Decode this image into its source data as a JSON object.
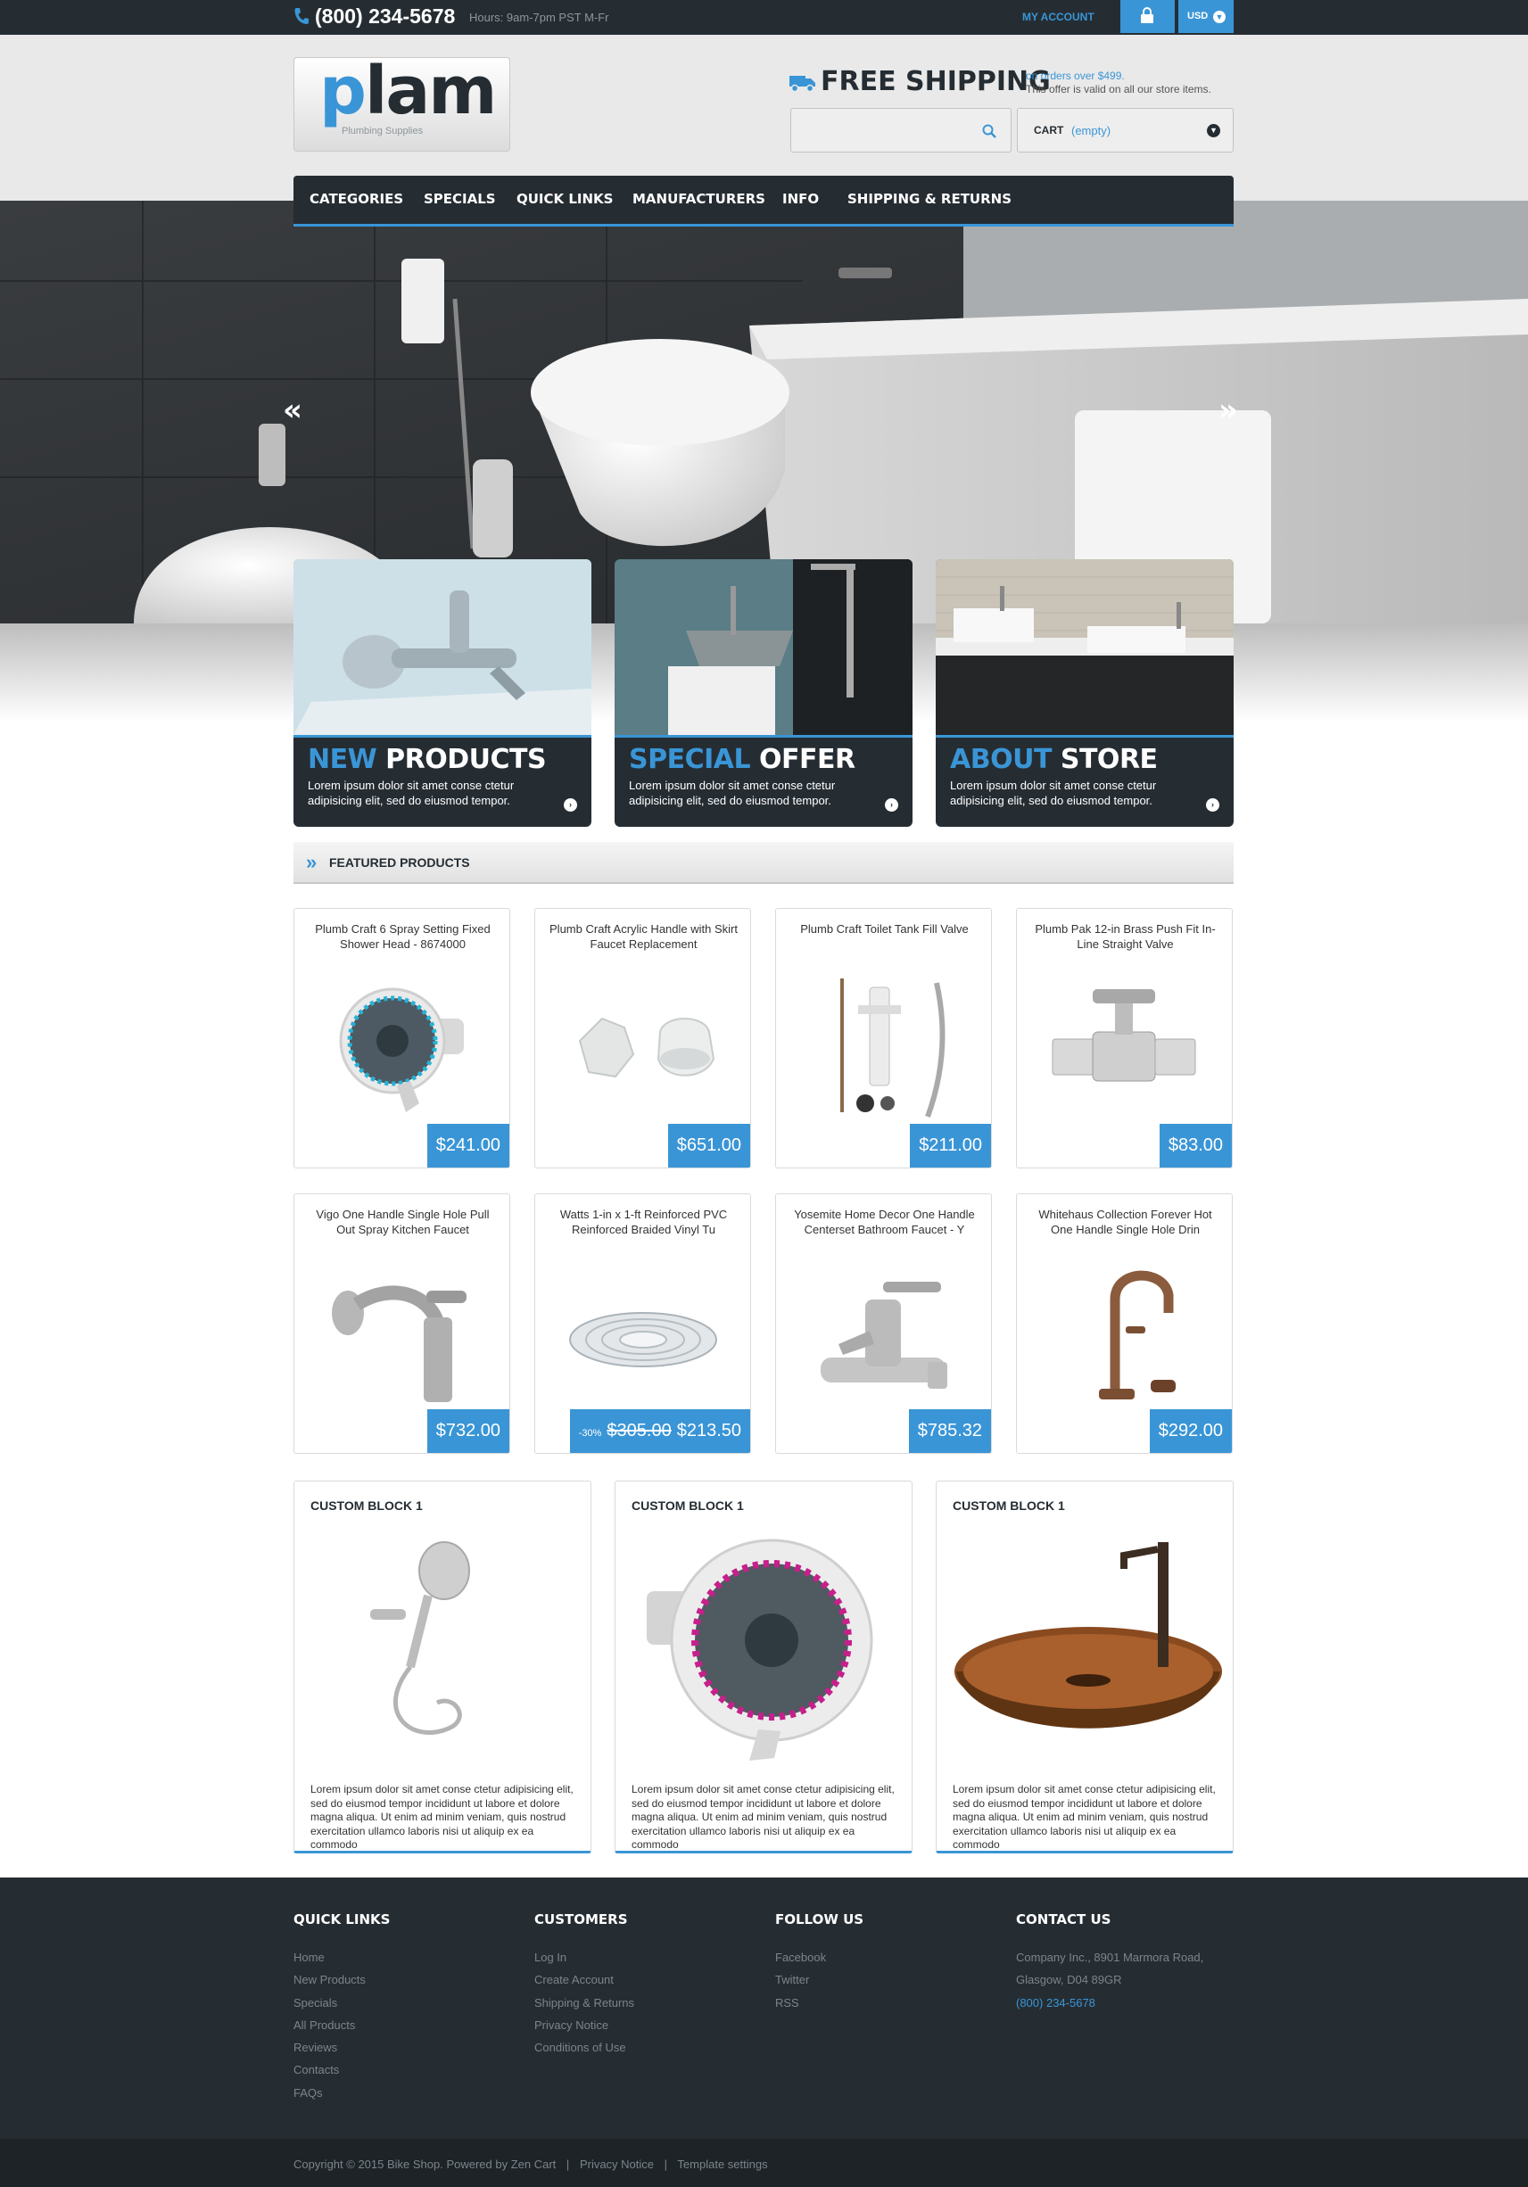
{
  "topbar": {
    "phone_icon": "phone-icon",
    "phone": "(800) 234-5678",
    "hours": "Hours: 9am-7pm PST M-Fr",
    "my_account": "MY ACCOUNT",
    "lock_icon": "lock-icon",
    "currency": "USD"
  },
  "header": {
    "logo_word": "lam",
    "logo_first": "p",
    "logo_sub": "Plumbing Supplies",
    "free_shipping": "FREE SHIPPING",
    "ship_note1": "on orders over $499.",
    "ship_note2": "This offer is valid on all our store items.",
    "search_placeholder": "",
    "cart_label": "CART",
    "cart_status": "(empty)"
  },
  "nav": [
    "CATEGORIES",
    "SPECIALS",
    "QUICK LINKS",
    "MANUFACTURERS",
    "INFO",
    "SHIPPING & RETURNS"
  ],
  "hero": {
    "prev_icon": "double-chevron-left-icon",
    "next_icon": "double-chevron-right-icon",
    "prev": "«",
    "next": "»"
  },
  "banners": [
    {
      "hl": "NEW",
      "rest": " PRODUCTS",
      "text": "Lorem ipsum dolor sit amet conse ctetur adipisicing elit, sed do eiusmod tempor."
    },
    {
      "hl": "SPECIAL",
      "rest": " OFFER",
      "text": "Lorem ipsum dolor sit amet conse ctetur adipisicing elit, sed do eiusmod tempor."
    },
    {
      "hl": "ABOUT",
      "rest": " STORE",
      "text": "Lorem ipsum dolor sit amet conse ctetur adipisicing elit, sed do eiusmod tempor."
    }
  ],
  "featured": {
    "title": "FEATURED PRODUCTS",
    "products": [
      {
        "name": "Plumb Craft 6 Spray Setting Fixed Shower Head - 8674000",
        "price": "$241.00"
      },
      {
        "name": "Plumb Craft Acrylic Handle with Skirt Faucet Replacement",
        "price": "$651.00"
      },
      {
        "name": "Plumb Craft Toilet Tank Fill Valve",
        "price": "$211.00"
      },
      {
        "name": "Plumb Pak 12-in Brass Push Fit In-Line Straight Valve",
        "price": "$83.00"
      },
      {
        "name": "Vigo One Handle Single Hole Pull Out Spray Kitchen Faucet",
        "price": "$732.00"
      },
      {
        "name": "Watts 1-in x 1-ft Reinforced PVC Reinforced Braided Vinyl Tu",
        "price": "$213.50",
        "discount": "-30%",
        "old_price": "$305.00"
      },
      {
        "name": "Yosemite Home Decor One Handle Centerset Bathroom Faucet - Y",
        "price": "$785.32"
      },
      {
        "name": "Whitehaus Collection Forever Hot One Handle Single Hole Drin",
        "price": "$292.00"
      }
    ]
  },
  "custom_blocks": [
    {
      "title": "CUSTOM BLOCK 1",
      "text": "Lorem ipsum dolor sit amet conse ctetur adipisicing elit, sed do eiusmod tempor incididunt ut labore et dolore magna aliqua. Ut enim ad minim veniam, quis nostrud exercitation ullamco laboris nisi ut aliquip ex ea commodo"
    },
    {
      "title": "CUSTOM BLOCK 1",
      "text": "Lorem ipsum dolor sit amet conse ctetur adipisicing elit, sed do eiusmod tempor incididunt ut labore et dolore magna aliqua. Ut enim ad minim veniam, quis nostrud exercitation ullamco laboris nisi ut aliquip ex ea commodo"
    },
    {
      "title": "CUSTOM BLOCK 1",
      "text": "Lorem ipsum dolor sit amet conse ctetur adipisicing elit, sed do eiusmod tempor incididunt ut labore et dolore magna aliqua. Ut enim ad minim veniam, quis nostrud exercitation ullamco laboris nisi ut aliquip ex ea commodo"
    }
  ],
  "footer": {
    "quick_links": {
      "title": "QUICK LINKS",
      "items": [
        "Home",
        "New Products",
        "Specials",
        "All Products",
        "Reviews",
        "Contacts",
        "FAQs"
      ]
    },
    "customers": {
      "title": "CUSTOMERS",
      "items": [
        "Log In",
        "Create Account",
        "Shipping & Returns",
        "Privacy Notice",
        "Conditions of Use"
      ]
    },
    "follow": {
      "title": "FOLLOW US",
      "items": [
        "Facebook",
        "Twitter",
        "RSS"
      ]
    },
    "contact": {
      "title": "CONTACT US",
      "line1": "Company Inc., 8901 Marmora Road,",
      "line2": "Glasgow, D04 89GR",
      "phone": "(800) 234-5678"
    },
    "copyright": "Copyright © 2015 Bike Shop. Powered by Zen Cart",
    "privacy": "Privacy Notice",
    "template": "Template settings",
    "separator": "|"
  },
  "colors": {
    "accent": "#3a95d6",
    "dark": "#252d33"
  }
}
